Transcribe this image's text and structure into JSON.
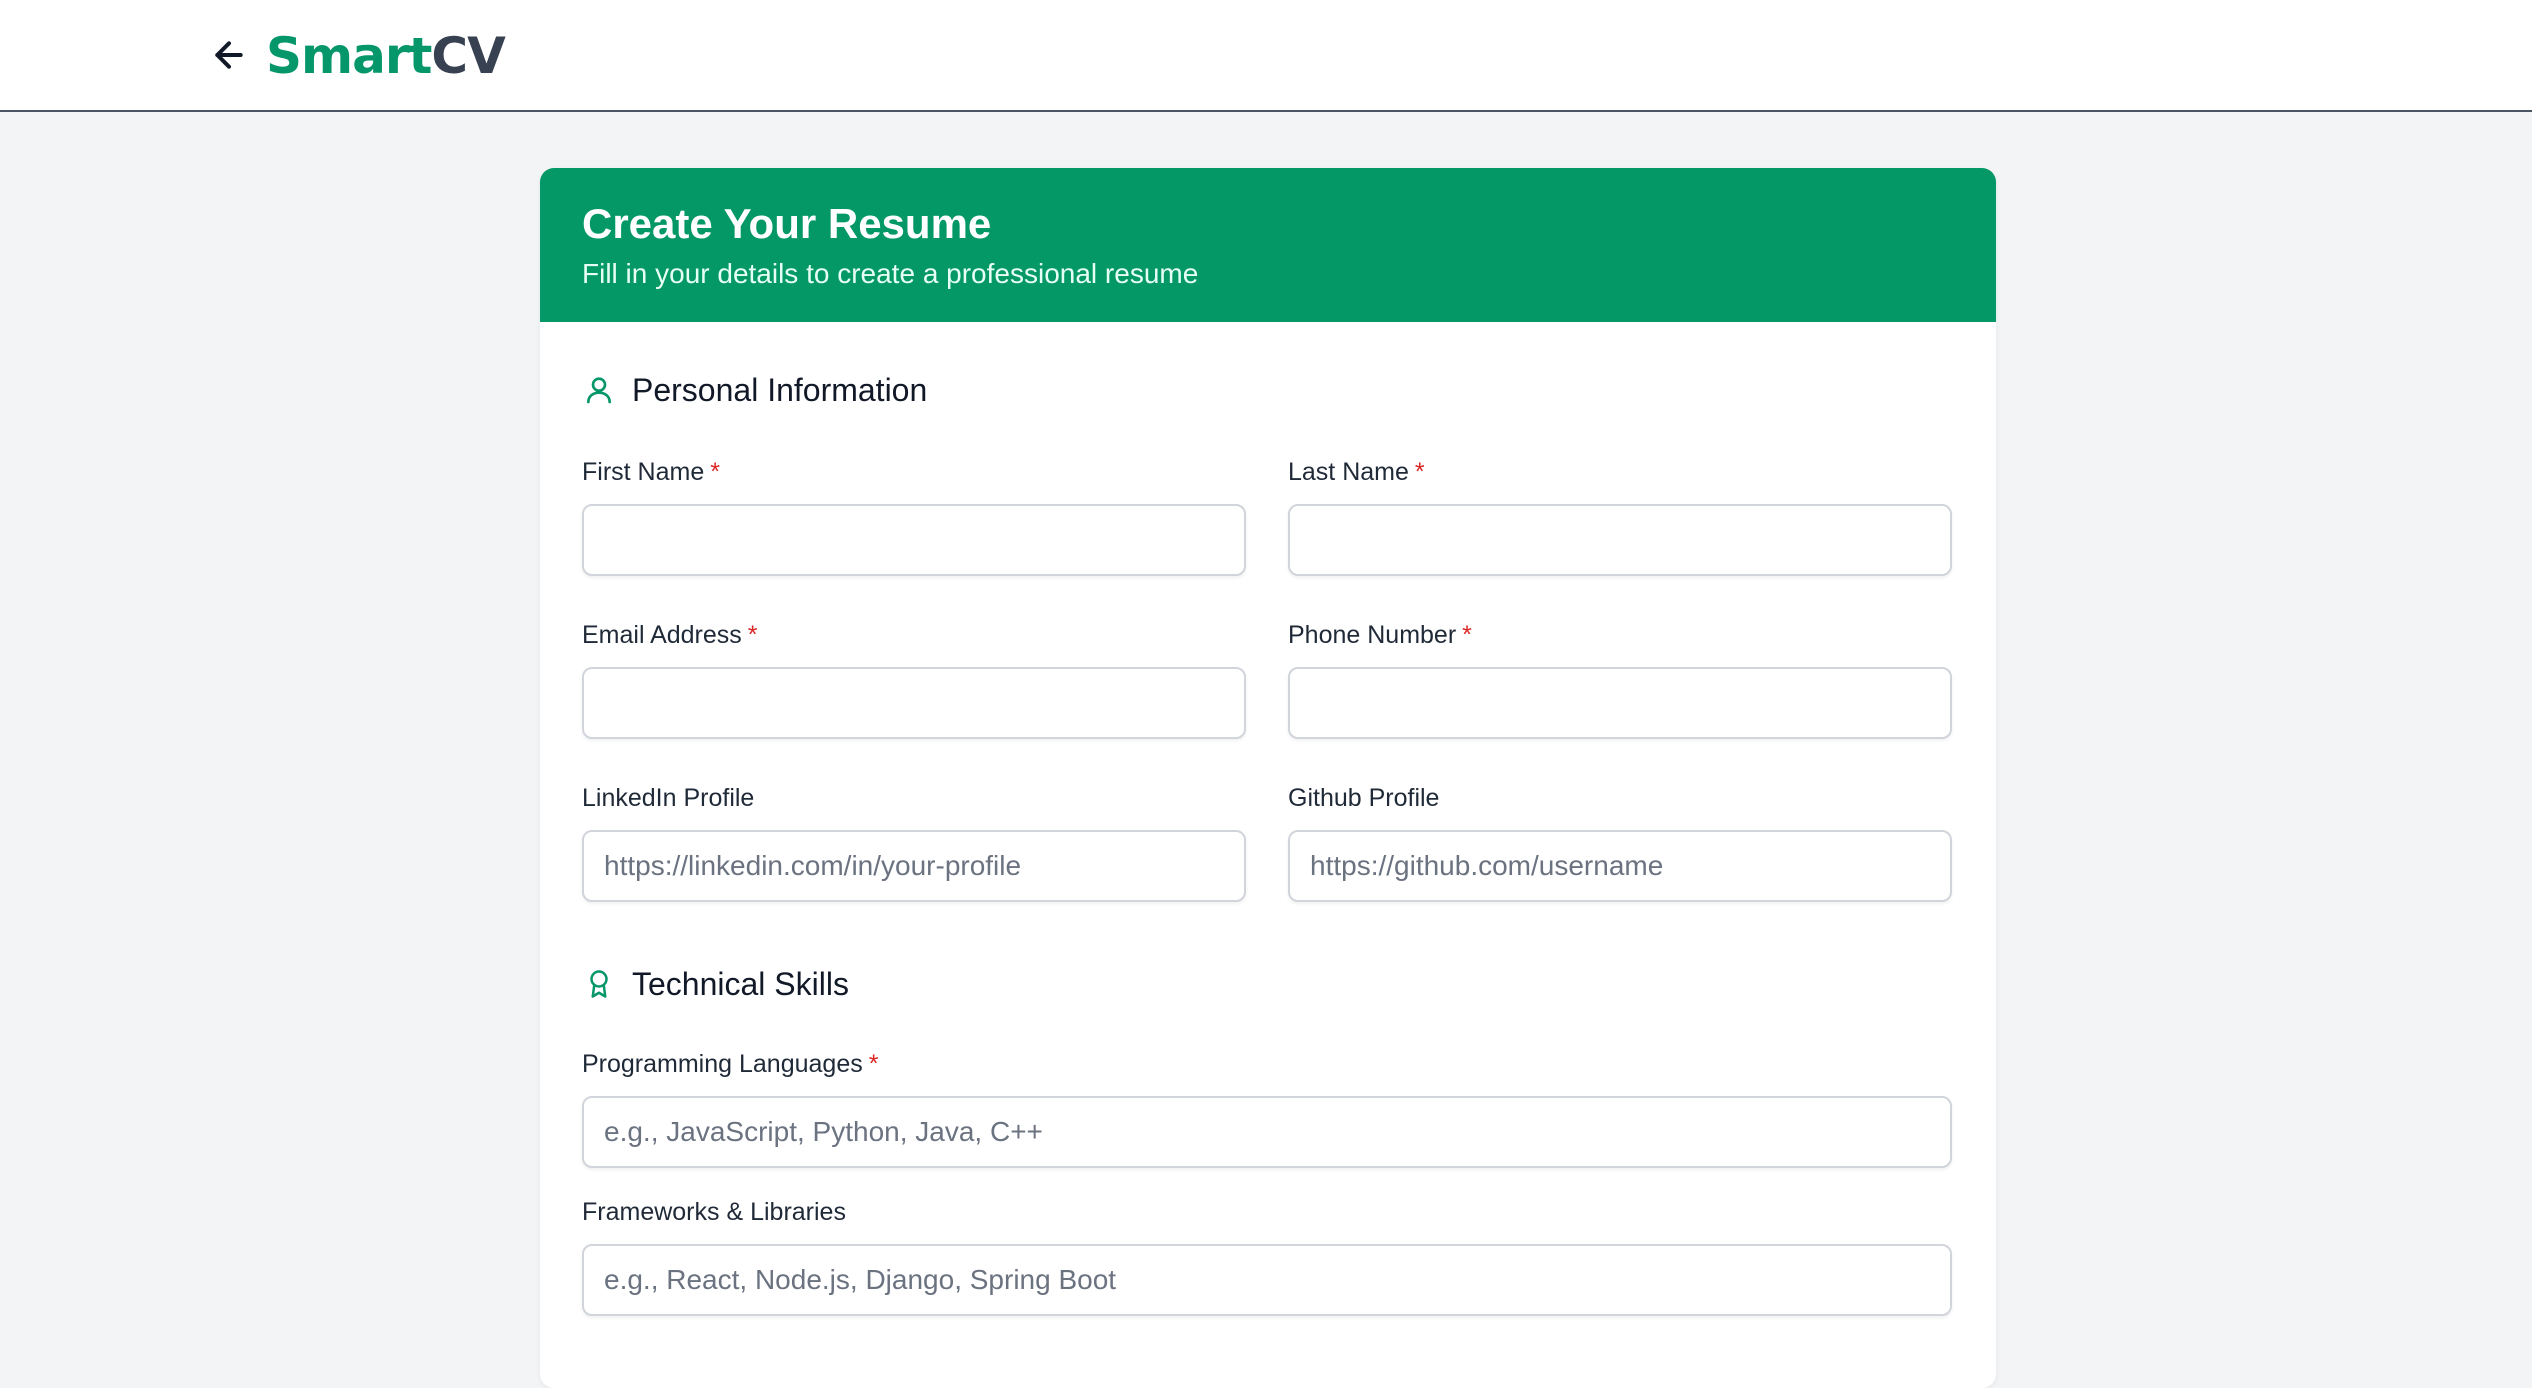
{
  "header": {
    "logo_part1": "Smart",
    "logo_part2": "CV",
    "back_icon": "arrow-left-icon"
  },
  "colors": {
    "brand_green": "#039865",
    "logo_green": "#059669",
    "logo_dark": "#374151",
    "required_red": "#dc2626"
  },
  "form": {
    "title": "Create Your Resume",
    "subtitle": "Fill in your details to create a professional resume",
    "personal": {
      "title": "Personal Information",
      "icon": "user-icon",
      "first_name": {
        "label": "First Name",
        "required": "*",
        "value": "",
        "placeholder": ""
      },
      "last_name": {
        "label": "Last Name",
        "required": "*",
        "value": "",
        "placeholder": ""
      },
      "email": {
        "label": "Email Address",
        "required": "*",
        "value": "",
        "placeholder": ""
      },
      "phone": {
        "label": "Phone Number",
        "required": "*",
        "value": "",
        "placeholder": ""
      },
      "linkedin": {
        "label": "LinkedIn Profile",
        "value": "",
        "placeholder": "https://linkedin.com/in/your-profile"
      },
      "github": {
        "label": "Github Profile",
        "value": "",
        "placeholder": "https://github.com/username"
      }
    },
    "skills": {
      "title": "Technical Skills",
      "icon": "award-icon",
      "languages": {
        "label": "Programming Languages",
        "required": "*",
        "value": "",
        "placeholder": "e.g., JavaScript, Python, Java, C++"
      },
      "frameworks": {
        "label": "Frameworks & Libraries",
        "value": "",
        "placeholder": "e.g., React, Node.js, Django, Spring Boot"
      }
    }
  }
}
